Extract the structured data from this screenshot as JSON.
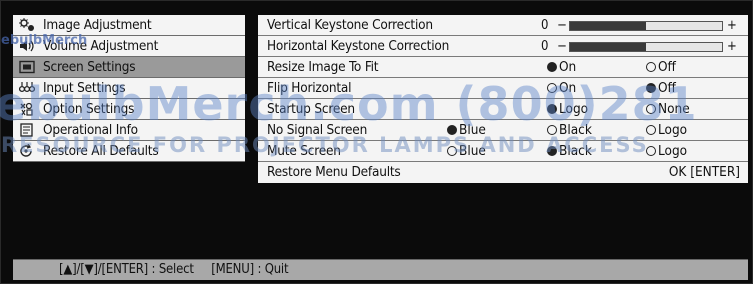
{
  "sidebar": {
    "items": [
      {
        "label": "Image Adjustment",
        "icon": "image-adjust-icon",
        "active": false
      },
      {
        "label": "Volume Adjustment",
        "icon": "volume-icon",
        "active": false
      },
      {
        "label": "Screen Settings",
        "icon": "screen-icon",
        "active": true
      },
      {
        "label": "Input Settings",
        "icon": "input-icon",
        "active": false
      },
      {
        "label": "Option Settings",
        "icon": "option-icon",
        "active": false
      },
      {
        "label": "Operational Info",
        "icon": "info-icon",
        "active": false
      },
      {
        "label": "Restore All Defaults",
        "icon": "restore-icon",
        "active": false
      }
    ]
  },
  "settings": {
    "vertical_keystone": {
      "label": "Vertical Keystone Correction",
      "value": "0",
      "minus": "−",
      "plus": "+",
      "level": 0.5
    },
    "horizontal_keystone": {
      "label": "Horizontal Keystone Correction",
      "value": "0",
      "minus": "−",
      "plus": "+",
      "level": 0.5
    },
    "resize_image": {
      "label": "Resize Image To Fit",
      "options": [
        "On",
        "Off"
      ],
      "selected": "On"
    },
    "flip_horizontal": {
      "label": "Flip Horizontal",
      "options": [
        "On",
        "Off"
      ],
      "selected": "Off"
    },
    "startup_screen": {
      "label": "Startup Screen",
      "options": [
        "Logo",
        "None"
      ],
      "selected": "Logo"
    },
    "no_signal_screen": {
      "label": "No Signal Screen",
      "options": [
        "Blue",
        "Black",
        "Logo"
      ],
      "selected": "Blue"
    },
    "mute_screen": {
      "label": "Mute Screen",
      "options": [
        "Blue",
        "Black",
        "Logo"
      ],
      "selected": "Black"
    },
    "restore_menu": {
      "label": "Restore Menu Defaults",
      "action": "OK [ENTER]"
    }
  },
  "footer": {
    "select_hint": "[▲]/[▼]/[ENTER] : Select",
    "quit_hint": "[MENU] : Quit"
  },
  "watermark": {
    "top": "ebulbMerch",
    "big": "ebulbMerch.com (800)281",
    "small": "RESOURCE FOR PROJECTOR LAMPS AND ACCESS"
  }
}
